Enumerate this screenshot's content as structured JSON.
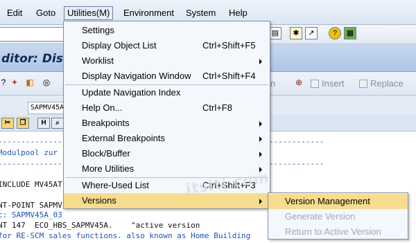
{
  "menubar": {
    "items": [
      {
        "label": "Edit"
      },
      {
        "label": "Goto"
      },
      {
        "label": "Utilities(M)"
      },
      {
        "label": "Environment"
      },
      {
        "label": "System"
      },
      {
        "label": "Help"
      }
    ]
  },
  "window": {
    "title_fragment": "ditor: Displ"
  },
  "app_toolbar": {
    "insert_label": "Insert",
    "replace_label": "Replace",
    "partial_label": "n"
  },
  "program_field": {
    "value": "SAPMV45A"
  },
  "utilities_menu": {
    "items": [
      {
        "label": "Settings",
        "shortcut": ""
      },
      {
        "label": "Display Object List",
        "shortcut": "Ctrl+Shift+F5"
      },
      {
        "label": "Worklist",
        "shortcut": ""
      },
      {
        "label": "Display Navigation Window",
        "shortcut": "Ctrl+Shift+F4"
      },
      {
        "label": "Update Navigation Index",
        "shortcut": ""
      },
      {
        "label": "Help On...",
        "shortcut": "Ctrl+F8"
      },
      {
        "label": "Breakpoints",
        "shortcut": ""
      },
      {
        "label": "External Breakpoints",
        "shortcut": ""
      },
      {
        "label": "Block/Buffer",
        "shortcut": ""
      },
      {
        "label": "More Utilities",
        "shortcut": ""
      },
      {
        "label": "Where-Used List",
        "shortcut": "Ctrl+Shift+F3"
      },
      {
        "label": "Versions",
        "shortcut": ""
      }
    ]
  },
  "versions_submenu": {
    "items": [
      {
        "label": "Version Management"
      },
      {
        "label": "Generate Version"
      },
      {
        "label": "Return to Active Version"
      }
    ]
  },
  "editor": {
    "lines": [
      "-----------------------------------------------------------------------",
      "Modulpool zur",
      "-----------------------------------------------------------------------",
      "INCLUDE MV45AT",
      "NT-POINT SAPMV",
      "c: SAPMV45A_03",
      "NT 147  ECO_HBS_SAPMV45A.    \"active version",
      "for RE-SCM sales functions. also known as Home Building"
    ]
  },
  "watermark": {
    "text": "itsiti.com"
  }
}
